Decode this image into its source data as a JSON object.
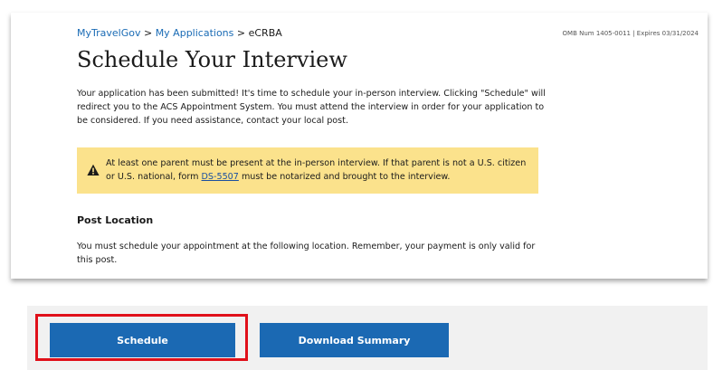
{
  "header": {
    "breadcrumb": [
      {
        "label": "MyTravelGov",
        "link": true
      },
      {
        "label": "My Applications",
        "link": true
      },
      {
        "label": "eCRBA",
        "link": false
      }
    ],
    "separator": ">",
    "omb": "OMB Num 1405-0011 | Expires 03/31/2024",
    "title": "Schedule Your Interview"
  },
  "main": {
    "intro": "Your application has been submitted! It's time to schedule your in-person interview. Clicking \"Schedule\" will redirect you to the ACS Appointment System. You must attend the interview in order for your application to be considered. If you need assistance, contact your local post.",
    "alert": {
      "icon": "warning-icon",
      "text_before": "At least one parent must be present at the in-person interview. If that parent is not a U.S. citizen or U.S. national, form ",
      "link": "DS-5507",
      "text_after": " must be notarized and brought to the interview.",
      "color": "#fbe28c"
    },
    "post_location": {
      "heading": "Post Location",
      "text": "You must schedule your appointment at the following location. Remember, your payment is only valid for this post."
    }
  },
  "actions": {
    "schedule_label": "Schedule",
    "download_label": "Download Summary",
    "button_color": "#1b69b3",
    "highlight_color": "#e0101a"
  }
}
